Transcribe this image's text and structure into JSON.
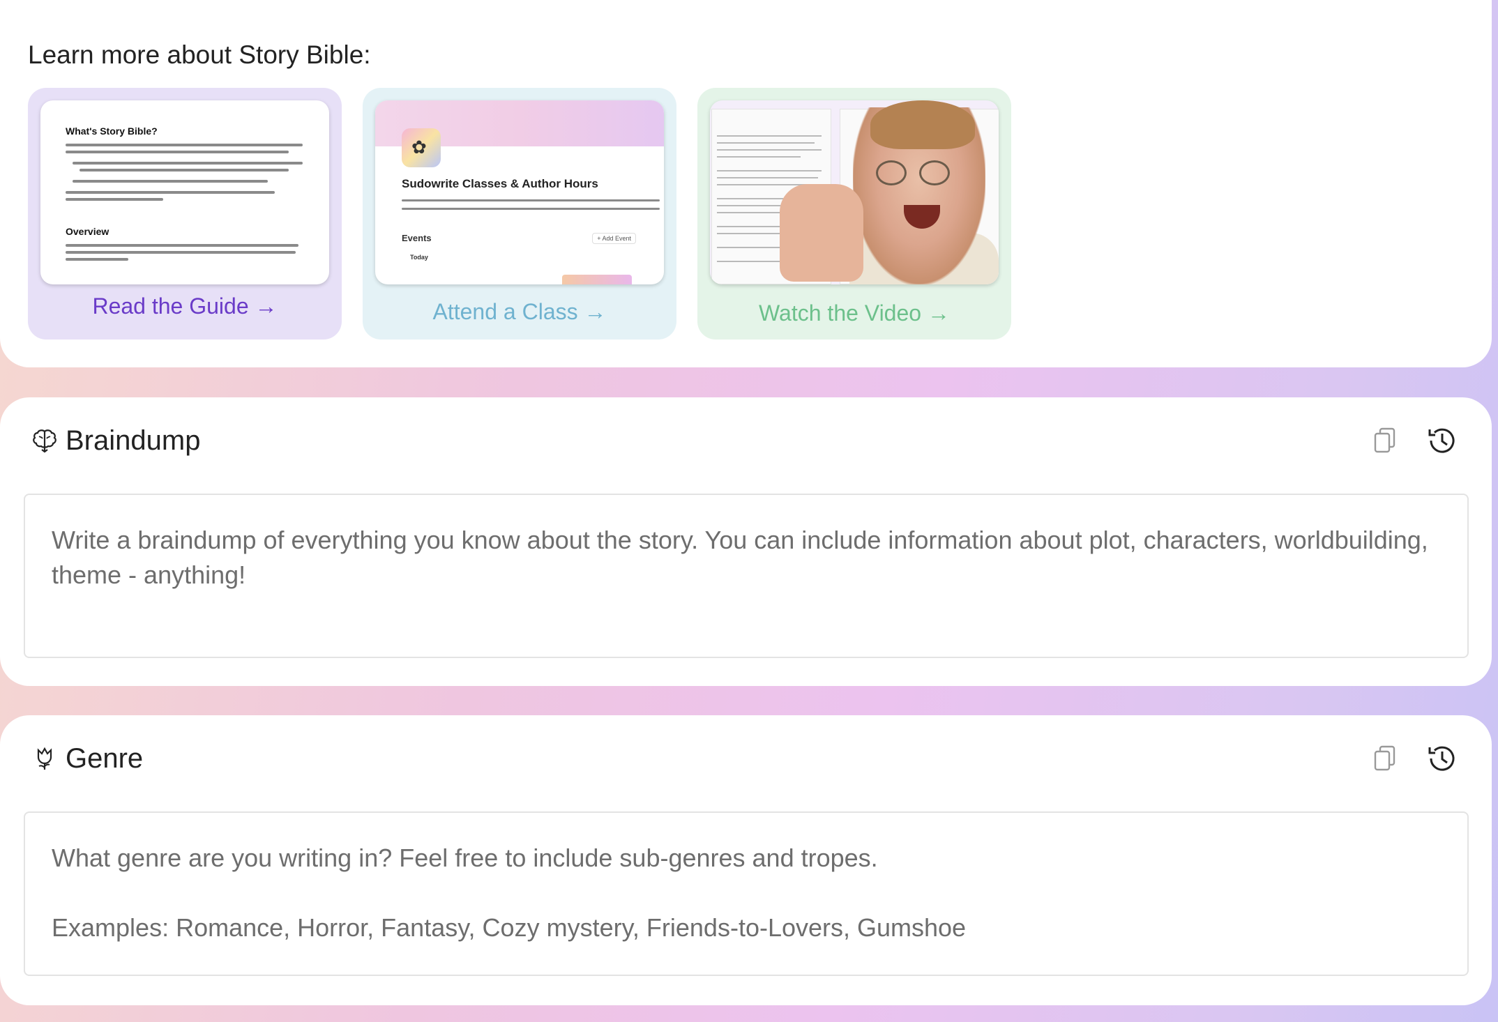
{
  "learn": {
    "heading": "Learn more about Story Bible:",
    "cards": [
      {
        "link": "Read the Guide →"
      },
      {
        "link": "Attend a Class →"
      },
      {
        "link": "Watch the Video →"
      }
    ],
    "guide_thumb": {
      "title": "What's Story Bible?",
      "overview": "Overview"
    },
    "class_thumb": {
      "title": "Sudowrite Classes & Author Hours",
      "events": "Events",
      "add_event": "+ Add Event",
      "today": "Today"
    }
  },
  "braindump": {
    "title": "Braindump",
    "placeholder": "Write a braindump of everything you know about the story. You can include information about plot, characters, worldbuilding, theme - anything!"
  },
  "genre": {
    "title": "Genre",
    "placeholder": "What genre are you writing in? Feel free to include sub-genres and tropes.\n\nExamples: Romance, Horror, Fantasy, Cozy mystery, Friends-to-Lovers, Gumshoe"
  },
  "colors": {
    "guide_accent": "#6a3bc8",
    "class_accent": "#6fb2cf",
    "video_accent": "#6cc08b"
  },
  "icons": {
    "braindump": "brain-icon",
    "genre": "flower-icon",
    "copy": "copy-icon",
    "history": "history-icon"
  }
}
